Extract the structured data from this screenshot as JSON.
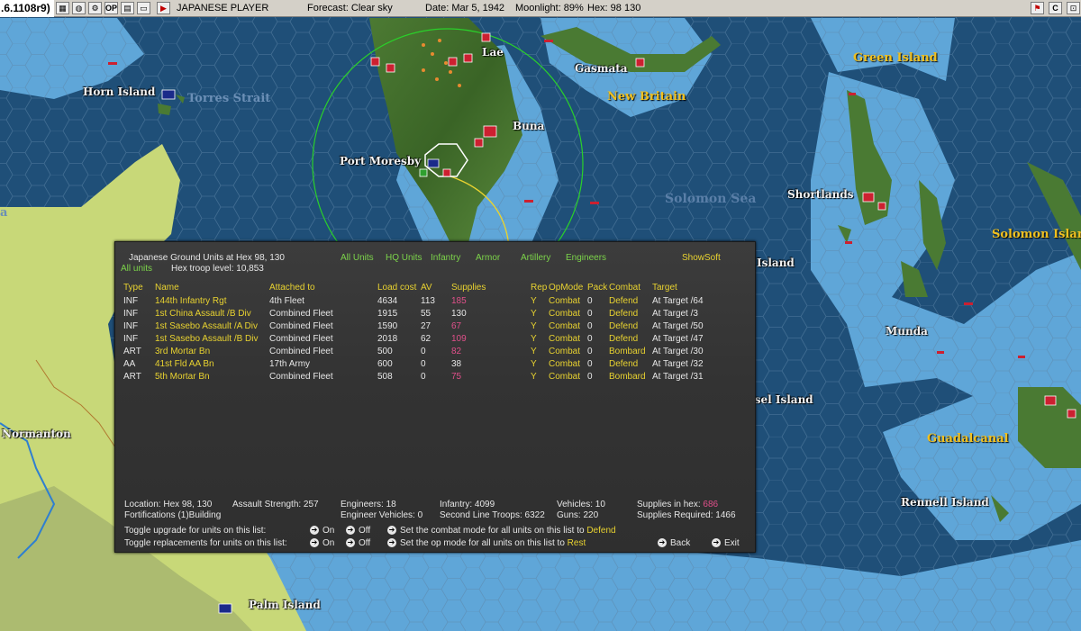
{
  "window": {
    "title_fragment": ".6.1108r9)"
  },
  "toolbar": {
    "player": "JAPANESE PLAYER",
    "forecast": "Forecast: Clear sky",
    "date": "Date: Mar 5, 1942",
    "moonlight": "Moonlight: 89%",
    "hex": "Hex: 98 130",
    "icons": [
      "map-icon",
      "globe-icon",
      "settings-icon",
      "op-icon",
      "doc-icon",
      "window-icon",
      "end-turn-icon",
      "flag-icon",
      "close-icon",
      "info-icon",
      "exit-icon"
    ],
    "op_label": "OP",
    "right_c": "C"
  },
  "map": {
    "places": {
      "lae": "Lae",
      "gasmata": "Gasmata",
      "green_island": "Green Island",
      "horn_island": "Horn Island",
      "torres_strait": "Torres Strait",
      "new_britain": "New Britain",
      "buna": "Buna",
      "port_moresby": "Port Moresby",
      "shortlands": "Shortlands",
      "solomon_sea": "Solomon Sea",
      "solomon_islands": "Solomon Islands",
      "island_partial": "Island",
      "munda": "Munda",
      "russel_island": "ssel Island",
      "guadalcanal": "Guadalcanal",
      "rennell_island": "Rennell Island",
      "normanton": "Normanton",
      "palm_island": "Palm Island",
      "edge_fragment": "a"
    },
    "colors": {
      "ocean_deep": "#1f4f78",
      "ocean_shallow": "#5fa6d8",
      "land_australia": "#c8d878",
      "jungle": "#3f6e2a",
      "japan_red": "#cc2030",
      "allied_blue": "#1a2a8a"
    }
  },
  "panel": {
    "title": "Japanese Ground Units at Hex 98, 130",
    "all_units_label": "All units",
    "troop_level": "Hex troop level: 10,853",
    "filters": {
      "all": "All Units",
      "hq": "HQ Units",
      "infantry": "Infantry",
      "armor": "Armor",
      "artillery": "Artillery",
      "engineers": "Engineers",
      "show_soft": "ShowSoft"
    },
    "columns": {
      "type": "Type",
      "name": "Name",
      "attached": "Attached to",
      "load": "Load cost",
      "av": "AV",
      "supplies": "Supplies",
      "rep": "Rep",
      "opmode": "OpMode",
      "pack": "Pack",
      "combat": "Combat",
      "target": "Target"
    },
    "rows": [
      {
        "type": "INF",
        "name": "144th Infantry Rgt",
        "attached": "4th Fleet",
        "load": "4634",
        "av": "113",
        "supplies": "185",
        "supplies_low": true,
        "rep": "Y",
        "opmode": "Combat",
        "pack": "0",
        "combat": "Defend",
        "target": "At Target /64"
      },
      {
        "type": "INF",
        "name": "1st China Assault /B Div",
        "attached": "Combined Fleet",
        "load": "1915",
        "av": "55",
        "supplies": "130",
        "supplies_low": false,
        "rep": "Y",
        "opmode": "Combat",
        "pack": "0",
        "combat": "Defend",
        "target": "At Target /3"
      },
      {
        "type": "INF",
        "name": "1st Sasebo Assault /A Div",
        "attached": "Combined Fleet",
        "load": "1590",
        "av": "27",
        "supplies": "67",
        "supplies_low": true,
        "rep": "Y",
        "opmode": "Combat",
        "pack": "0",
        "combat": "Defend",
        "target": "At Target /50"
      },
      {
        "type": "INF",
        "name": "1st Sasebo Assault /B Div",
        "attached": "Combined Fleet",
        "load": "2018",
        "av": "62",
        "supplies": "109",
        "supplies_low": true,
        "rep": "Y",
        "opmode": "Combat",
        "pack": "0",
        "combat": "Defend",
        "target": "At Target /47"
      },
      {
        "type": "ART",
        "name": "3rd Mortar Bn",
        "attached": "Combined Fleet",
        "load": "500",
        "av": "0",
        "supplies": "82",
        "supplies_low": true,
        "rep": "Y",
        "opmode": "Combat",
        "pack": "0",
        "combat": "Bombard",
        "target": "At Target /30"
      },
      {
        "type": "AA",
        "name": "41st Fld AA Bn",
        "attached": "17th Army",
        "load": "600",
        "av": "0",
        "supplies": "38",
        "supplies_low": false,
        "rep": "Y",
        "opmode": "Combat",
        "pack": "0",
        "combat": "Defend",
        "target": "At Target /32"
      },
      {
        "type": "ART",
        "name": "5th Mortar Bn",
        "attached": "Combined Fleet",
        "load": "508",
        "av": "0",
        "supplies": "75",
        "supplies_low": true,
        "rep": "Y",
        "opmode": "Combat",
        "pack": "0",
        "combat": "Bombard",
        "target": "At Target /31"
      }
    ],
    "footer": {
      "location": "Location: Hex 98, 130",
      "assault_strength": "Assault Strength: 257",
      "fortifications": "Fortifications (1)Building",
      "engineers": "Engineers:  18",
      "engineer_vehicles": "Engineer Vehicles:  0",
      "infantry": "Infantry: 4099",
      "second_line": "Second Line Troops: 6322",
      "vehicles": "Vehicles: 10",
      "guns": "Guns: 220",
      "supplies_in_hex_label": "Supplies in hex:",
      "supplies_in_hex_value": "686",
      "supplies_required": "Supplies Required:  1466",
      "toggle_upgrade": "Toggle upgrade for units on this list:",
      "toggle_replacements": "Toggle replacements for units on this list:",
      "on": "On",
      "off": "Off",
      "set_combat_mode": "Set the combat mode for all units on this list to",
      "combat_mode_value": "Defend",
      "set_op_mode": "Set the op mode for all units on this list to",
      "op_mode_value": "Rest",
      "back": "Back",
      "exit": "Exit"
    }
  }
}
